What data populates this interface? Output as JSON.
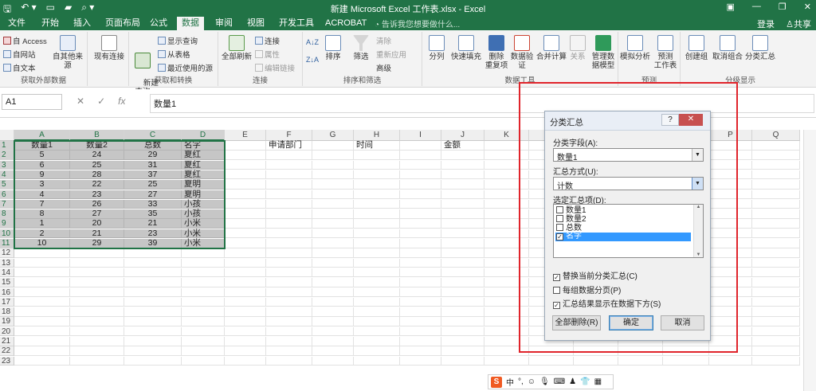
{
  "titlebar": {
    "title": "新建 Microsoft Excel 工作表.xlsx - Excel",
    "qat": [
      "save-icon",
      "undo-icon",
      "new-icon",
      "open-icon",
      "preview-icon"
    ]
  },
  "tabs": [
    "文件",
    "开始",
    "插入",
    "页面布局",
    "公式",
    "数据",
    "审阅",
    "视图",
    "开发工具",
    "ACROBAT"
  ],
  "active_tab": "数据",
  "tell_me": "告诉我您想要做什么...",
  "login": "登录",
  "share": "共享",
  "ribbon": {
    "get_external": {
      "label": "获取外部数据",
      "items": [
        "自 Access",
        "自网站",
        "自文本"
      ],
      "other_sources": "自其他来源",
      "existing": "现有连接"
    },
    "get_transform": {
      "label": "获取和转换",
      "new_query": "新建\n查询",
      "items": [
        "显示查询",
        "从表格",
        "最近使用的源"
      ]
    },
    "connections": {
      "label": "连接",
      "refresh_all": "全部刷新",
      "items": [
        "连接",
        "属性",
        "编辑链接"
      ]
    },
    "sort_filter": {
      "label": "排序和筛选",
      "sort": "排序",
      "filter": "筛选",
      "items": [
        "清除",
        "重新应用",
        "高级"
      ]
    },
    "data_tools": {
      "label": "数据工具",
      "items": [
        "分列",
        "快速填充",
        "删除\n重复项",
        "数据验\n证",
        "合并计算",
        "关系",
        "管理数\n据模型"
      ]
    },
    "forecast": {
      "label": "预测",
      "items": [
        "模拟分析",
        "预测\n工作表"
      ]
    },
    "outline": {
      "label": "分级显示",
      "items": [
        "创建组",
        "取消组合",
        "分类汇总"
      ]
    }
  },
  "formula_bar": {
    "name_box": "A1",
    "content": "数量1"
  },
  "sheet": {
    "columns": [
      "A",
      "B",
      "C",
      "D",
      "E",
      "F",
      "G",
      "H",
      "I",
      "J",
      "K",
      "L",
      "M",
      "N",
      "O",
      "P",
      "Q"
    ],
    "rows": [
      [
        "数量1",
        "数量2",
        "总数",
        "名字",
        "",
        "申请部门",
        "",
        "时间",
        "",
        "金额"
      ],
      [
        "5",
        "24",
        "29",
        "夏红"
      ],
      [
        "6",
        "25",
        "31",
        "夏红"
      ],
      [
        "9",
        "28",
        "37",
        "夏红"
      ],
      [
        "3",
        "22",
        "25",
        "夏明"
      ],
      [
        "4",
        "23",
        "27",
        "夏明"
      ],
      [
        "7",
        "26",
        "33",
        "小孩"
      ],
      [
        "8",
        "27",
        "35",
        "小孩"
      ],
      [
        "1",
        "20",
        "21",
        "小米"
      ],
      [
        "2",
        "21",
        "23",
        "小米"
      ],
      [
        "10",
        "29",
        "39",
        "小米"
      ]
    ],
    "row_count": 23
  },
  "dialog": {
    "title": "分类汇总",
    "group_by_label": "分类字段(A):",
    "group_by_value": "数量1",
    "function_label": "汇总方式(U):",
    "function_value": "计数",
    "add_to_label": "选定汇总项(D):",
    "fields": [
      {
        "name": "数量1",
        "checked": false
      },
      {
        "name": "数量2",
        "checked": false
      },
      {
        "name": "总数",
        "checked": false
      },
      {
        "name": "名字",
        "checked": true
      }
    ],
    "options": [
      {
        "label": "替换当前分类汇总(C)",
        "checked": true
      },
      {
        "label": "每组数据分页(P)",
        "checked": false
      },
      {
        "label": "汇总结果显示在数据下方(S)",
        "checked": true
      }
    ],
    "remove_all": "全部删除(R)",
    "ok": "确定",
    "cancel": "取消"
  },
  "ime": {
    "lang": "中"
  }
}
